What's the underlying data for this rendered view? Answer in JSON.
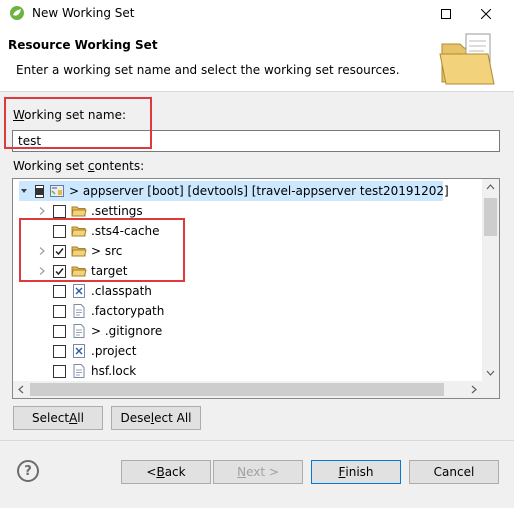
{
  "window": {
    "title": "New Working Set",
    "maximize_glyph": "☐",
    "close_glyph": "✕"
  },
  "header": {
    "title": "Resource Working Set",
    "description": "Enter a working set name and select the working set resources."
  },
  "name_field": {
    "label_prefix": "W",
    "label_rest": "orking set name:",
    "value": "test"
  },
  "contents": {
    "label_prefix": "Working set ",
    "label_mnemonic": "c",
    "label_rest": "ontents:",
    "items": [
      {
        "label": "> appserver [boot] [devtools] [travel-appserver test20191202]",
        "icon": "project-icon",
        "checked": "partial",
        "expander": "expanded",
        "selected": true
      },
      {
        "label": ".settings",
        "icon": "folder-icon",
        "checked": "no",
        "expander": "collapsed"
      },
      {
        "label": ".sts4-cache",
        "icon": "folder-icon",
        "checked": "no",
        "expander": "none"
      },
      {
        "label": "> src",
        "icon": "folder-icon",
        "checked": "yes",
        "expander": "collapsed"
      },
      {
        "label": "target",
        "icon": "folder-icon",
        "checked": "yes",
        "expander": "collapsed"
      },
      {
        "label": ".classpath",
        "icon": "xml-file-icon",
        "checked": "no",
        "expander": "none"
      },
      {
        "label": ".factorypath",
        "icon": "file-icon",
        "checked": "no",
        "expander": "none"
      },
      {
        "label": "> .gitignore",
        "icon": "file-icon",
        "checked": "no",
        "expander": "none"
      },
      {
        "label": ".project",
        "icon": "xml-file-icon",
        "checked": "no",
        "expander": "none"
      },
      {
        "label": "hsf.lock",
        "icon": "file-icon",
        "checked": "no",
        "expander": "none"
      }
    ]
  },
  "buttons": {
    "select_all_pre": "Select ",
    "select_all_mn": "A",
    "select_all_post": "ll",
    "deselect_all_pre": "Dese",
    "deselect_all_mn": "l",
    "deselect_all_post": "ect All",
    "back_pre": "< ",
    "back_mn": "B",
    "back_post": "ack",
    "next_mn": "N",
    "next_post": "ext >",
    "finish_mn": "F",
    "finish_post": "inish",
    "cancel": "Cancel",
    "help_glyph": "?"
  },
  "colors": {
    "highlight_box": "#e0393b",
    "selection": "#cce8ff",
    "folder": "#e8b84a"
  }
}
